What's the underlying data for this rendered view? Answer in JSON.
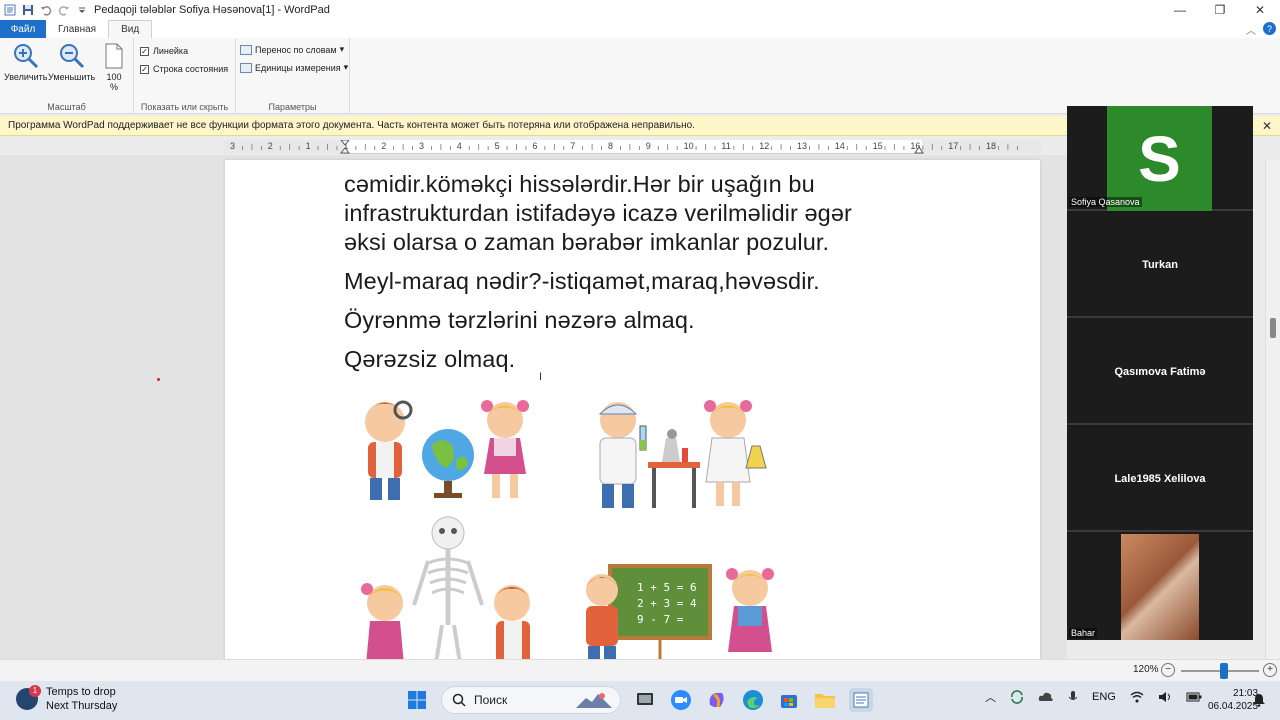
{
  "window": {
    "title": "Pedaqoji tələblər Sofiya Həsənova[1] - WordPad",
    "minimize": "—",
    "maximize": "❐",
    "close": "✕"
  },
  "ribbon_tabs": {
    "file": "Файл",
    "home": "Главная",
    "view": "Вид"
  },
  "ribbon": {
    "zoom_in": "Увеличить",
    "zoom_out": "Уменьшить",
    "zoom_100_line1": "100",
    "zoom_100_line2": "%",
    "group_scale": "Масштаб",
    "ruler_label": "Линейка",
    "statusbar_label": "Строка состояния",
    "group_show_hide": "Показать или скрыть",
    "wrap_label": "Перенос по словам",
    "units_label": "Единицы измерения",
    "group_params": "Параметры"
  },
  "infobar": {
    "message": "Программа WordPad поддерживает не все функции формата этого документа. Часть контента может быть потеряна или отображена неправильно.",
    "close": "✕"
  },
  "ruler": {
    "labels": [
      "3",
      "2",
      "1",
      "1",
      "2",
      "3",
      "4",
      "5",
      "6",
      "7",
      "8",
      "9",
      "10",
      "11",
      "12",
      "13",
      "14",
      "15",
      "16",
      "17",
      "18"
    ]
  },
  "document": {
    "line1": "cəmidir.köməkçi hissələrdir.Hər bir uşağın bu",
    "line2": "infrastrukturdan istifadəyə icazə verilməlidir əgər",
    "line3": "əksi olarsa o zaman bərabər imkanlar pozulur.",
    "line4": "Meyl-maraq nədir?-istiqamət,maraq,həvəsdir.",
    "line5": "Öyrənmə tərzlərini nəzərə almaq.",
    "line6": "Qərəzsiz olmaq.",
    "board_line1": "1 + 5 = 6",
    "board_line2": "2 + 3 = 4",
    "board_line3": "9 - 7 ="
  },
  "zoom_participants": [
    {
      "name": "Sofiya Qasanova",
      "initial": "S",
      "avatar_color": "#2d8a2a"
    },
    {
      "name": "Turkan"
    },
    {
      "name": "Qasımova Fatimə"
    },
    {
      "name": "Lale1985 Xelilova"
    },
    {
      "name": "Bahar"
    }
  ],
  "statusbar": {
    "zoom_percent": "120%",
    "zoom_minus": "−",
    "zoom_plus": "+",
    "zoom_level": 0.55
  },
  "taskbar": {
    "weather_line1": "Temps to drop",
    "weather_line2": "Next Thursday",
    "weather_badge": "1",
    "search_placeholder": "Поиск",
    "language": "ENG",
    "time": "21:03",
    "date": "06.04.2025"
  },
  "colors": {
    "accent": "#1e6fc9",
    "infobar_bg": "#fdf6c9"
  }
}
